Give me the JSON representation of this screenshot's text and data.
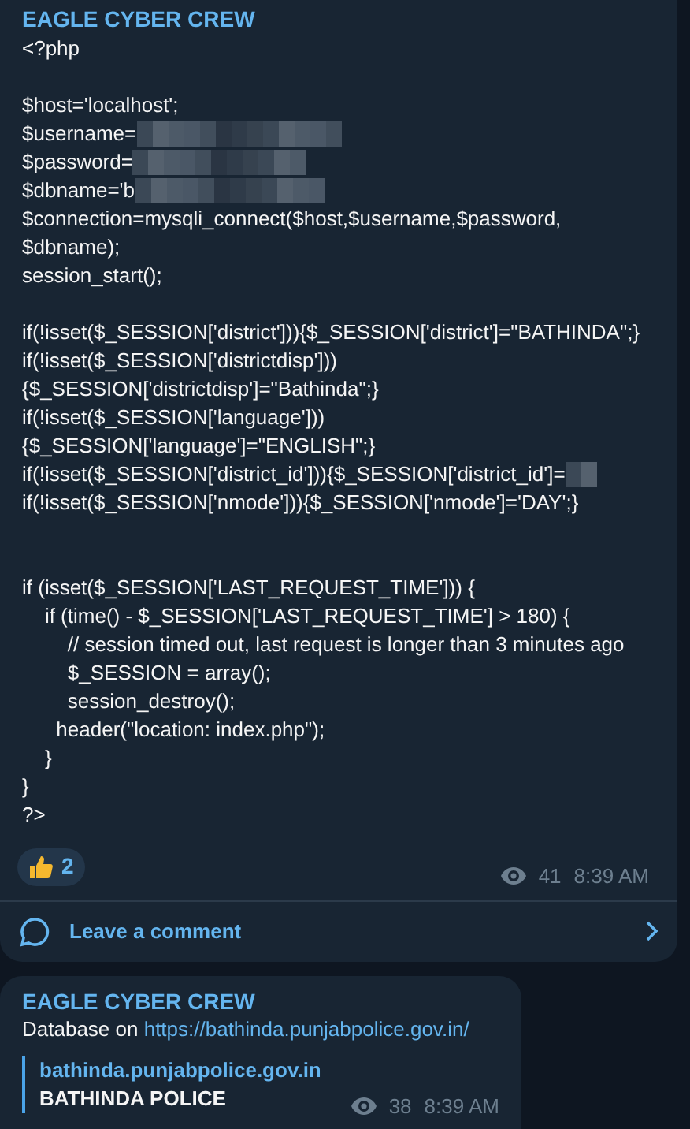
{
  "post": {
    "channel": "EAGLE CYBER CREW",
    "code_lines": [
      {
        "kind": "text",
        "text": "<?php"
      },
      {
        "kind": "blank"
      },
      {
        "kind": "text",
        "text": "$host='localhost';"
      },
      {
        "kind": "redacted",
        "text": "$username="
      },
      {
        "kind": "redacted",
        "text": "$password="
      },
      {
        "kind": "redacted",
        "text": "$dbname='b"
      },
      {
        "kind": "text",
        "text": "$connection=mysqli_connect($host,$username,$password,"
      },
      {
        "kind": "text",
        "text": "$dbname);"
      },
      {
        "kind": "text",
        "text": "session_start();"
      },
      {
        "kind": "blank"
      },
      {
        "kind": "text",
        "text": "if(!isset($_SESSION['district'])){$_SESSION['district']=\"BATHINDA\";}"
      },
      {
        "kind": "text",
        "text": "if(!isset($_SESSION['districtdisp']))"
      },
      {
        "kind": "text",
        "text": "{$_SESSION['districtdisp']=\"Bathinda\";}"
      },
      {
        "kind": "text",
        "text": "if(!isset($_SESSION['language']))"
      },
      {
        "kind": "text",
        "text": "{$_SESSION['language']=\"ENGLISH\";}"
      },
      {
        "kind": "redacted",
        "text": "if(!isset($_SESSION['district_id'])){$_SESSION['district_id']="
      },
      {
        "kind": "text",
        "text": "if(!isset($_SESSION['nmode'])){$_SESSION['nmode']='DAY';}"
      },
      {
        "kind": "blank"
      },
      {
        "kind": "blank"
      },
      {
        "kind": "text",
        "text": "if (isset($_SESSION['LAST_REQUEST_TIME'])) {"
      },
      {
        "kind": "text",
        "text": "    if (time() - $_SESSION['LAST_REQUEST_TIME'] > 180) {"
      },
      {
        "kind": "text",
        "text": "        // session timed out, last request is longer than 3 minutes ago"
      },
      {
        "kind": "text",
        "text": "        $_SESSION = array();"
      },
      {
        "kind": "text",
        "text": "        session_destroy();"
      },
      {
        "kind": "text",
        "text": "      header(\"location: index.php\");"
      },
      {
        "kind": "text",
        "text": "    }"
      },
      {
        "kind": "text",
        "text": "}"
      },
      {
        "kind": "text",
        "text": "?>"
      }
    ],
    "reaction": {
      "count": "2"
    },
    "views": "41",
    "time": "8:39 AM",
    "comment_label": "Leave a comment"
  },
  "post_2": {
    "channel": "EAGLE CYBER CREW",
    "text_prefix": "Database on",
    "link": "https://bathinda.punjabpolice.gov.in/",
    "preview": {
      "site": "bathinda.punjabpolice.gov.in",
      "title": "BATHINDA POLICE"
    },
    "views": "38",
    "time": "8:39 AM"
  }
}
